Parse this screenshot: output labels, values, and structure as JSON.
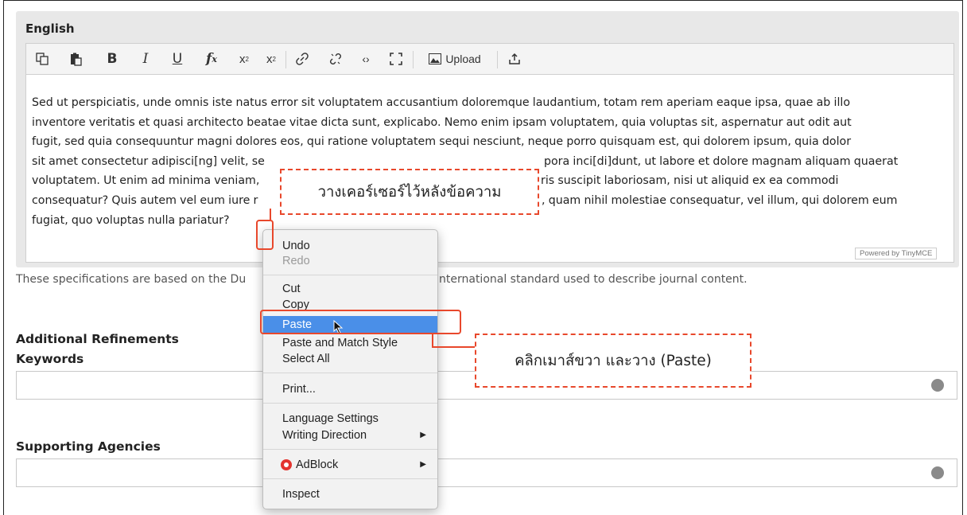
{
  "editor": {
    "section_title": "English",
    "toolbar": {
      "upload_label": "Upload"
    },
    "content_lines": [
      "Sed ut perspiciatis, unde omnis iste natus error sit voluptatem accusantium doloremque laudantium, totam rem aperiam eaque ipsa, quae ab illo",
      "inventore veritatis et quasi architecto beatae vitae dicta sunt, explicabo. Nemo enim ipsam voluptatem, quia voluptas sit, aspernatur aut odit aut",
      "fugit, sed quia consequuntur magni dolores eos, qui ratione voluptatem sequi nesciunt, neque porro quisquam est, qui dolorem ipsum, quia dolor",
      "sit amet consectetur adipisci[ng] velit, se",
      "voluptatem. Ut enim ad minima veniam,",
      "consequatur? Quis autem vel eum iure r",
      "fugiat, quo voluptas nulla pariatur?"
    ],
    "content_right": [
      "pora inci[di]dunt, ut labore et dolore magnam aliquam quaerat",
      "ris suscipit laboriosam, nisi ut aliquid ex ea commodi",
      ", quam nihil molestiae consequatur, vel illum, qui dolorem eum"
    ],
    "powered_by": "Powered by TinyMCE"
  },
  "spec_text_left": "These specifications are based on the Du",
  "spec_text_right": "nternational standard used to describe journal content.",
  "additional_refinements": "Additional Refinements",
  "keywords_label": "Keywords",
  "supporting_agencies_label": "Supporting Agencies",
  "context_menu": {
    "items": [
      {
        "label": "Undo",
        "disabled": false
      },
      {
        "label": "Redo",
        "disabled": true
      },
      {
        "label": "Cut",
        "disabled": false
      },
      {
        "label": "Copy",
        "disabled": false
      },
      {
        "label": "Paste",
        "disabled": false,
        "highlighted": true
      },
      {
        "label": "Paste and Match Style",
        "disabled": false
      },
      {
        "label": "Select All",
        "disabled": false
      },
      {
        "label": "Print...",
        "disabled": false
      },
      {
        "label": "Language Settings",
        "disabled": false
      },
      {
        "label": "Writing Direction",
        "disabled": false,
        "submenu": true
      },
      {
        "label": "AdBlock",
        "disabled": false,
        "submenu": true
      },
      {
        "label": "Inspect",
        "disabled": false
      }
    ]
  },
  "annotations": {
    "cursor_note": "วางเคอร์เซอร์ไว้หลังข้อความ",
    "paste_note": "คลิกเมาส์ขวา และวาง (Paste)"
  },
  "colors": {
    "annotation_red": "#e8482c",
    "menu_highlight": "#4a8fe8"
  }
}
